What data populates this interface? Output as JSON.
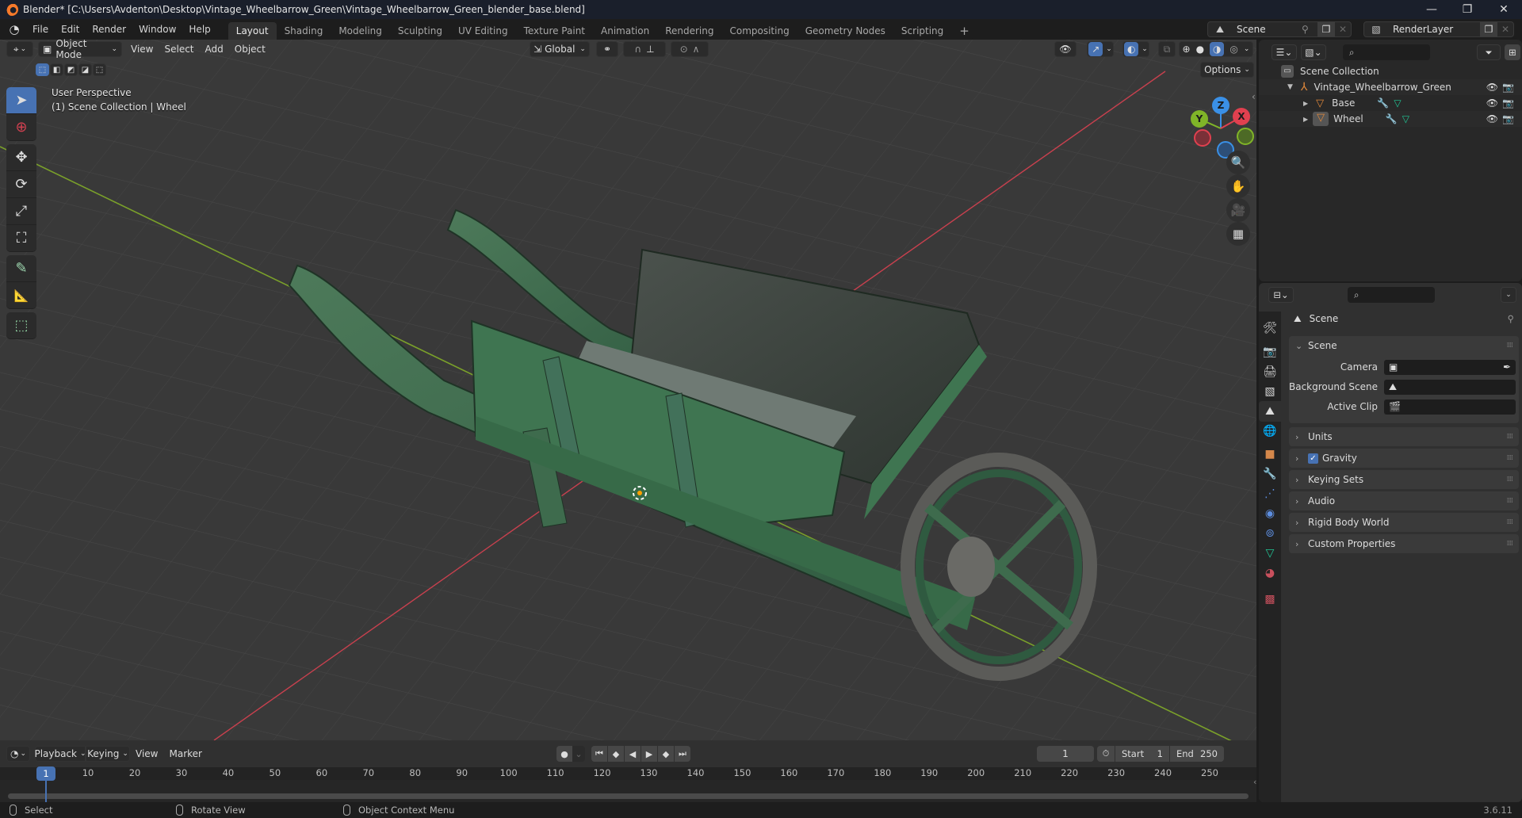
{
  "window": {
    "title": "Blender* [C:\\Users\\Avdenton\\Desktop\\Vintage_Wheelbarrow_Green\\Vintage_Wheelbarrow_Green_blender_base.blend]",
    "minimize": "—",
    "maximize": "❐",
    "close": "✕"
  },
  "menu": [
    "File",
    "Edit",
    "Render",
    "Window",
    "Help"
  ],
  "workspaces": [
    {
      "label": "Layout",
      "active": true
    },
    {
      "label": "Shading"
    },
    {
      "label": "Modeling"
    },
    {
      "label": "Sculpting"
    },
    {
      "label": "UV Editing"
    },
    {
      "label": "Texture Paint"
    },
    {
      "label": "Animation"
    },
    {
      "label": "Rendering"
    },
    {
      "label": "Compositing"
    },
    {
      "label": "Geometry Nodes"
    },
    {
      "label": "Scripting"
    }
  ],
  "add_workspace": "+",
  "scene_selector": {
    "value": "Scene"
  },
  "view_layer_selector": {
    "value": "RenderLayer"
  },
  "viewport": {
    "mode": "Object Mode",
    "menus": [
      "View",
      "Select",
      "Add",
      "Object"
    ],
    "transform_orientation": "Global",
    "options_label": "Options",
    "overlay_title": "User Perspective",
    "overlay_subtitle": "(1) Scene Collection | Wheel",
    "gizmo_axes": {
      "x": "X",
      "y": "Y",
      "z": "Z"
    },
    "colors": {
      "x_axis": "#e0404f",
      "y_axis": "#80b428",
      "z_axis": "#3a90e6",
      "grid_bg": "#393939",
      "accent": "#4772b3"
    }
  },
  "toolbar": [
    {
      "name": "select-box",
      "glyph": "➤"
    },
    {
      "name": "cursor",
      "glyph": "⊕"
    },
    {
      "name": "move",
      "glyph": "✥"
    },
    {
      "name": "rotate",
      "glyph": "⟳"
    },
    {
      "name": "scale",
      "glyph": "⤢"
    },
    {
      "name": "transform",
      "glyph": "⛶"
    },
    {
      "name": "annotate",
      "glyph": "✎"
    },
    {
      "name": "measure",
      "glyph": "📐"
    },
    {
      "name": "add-cube",
      "glyph": "⬚"
    }
  ],
  "outliner": {
    "root": "Scene Collection",
    "items": [
      {
        "label": "Vintage_Wheelbarrow_Green",
        "type": "empty",
        "depth": 1,
        "expanded": true
      },
      {
        "label": "Base",
        "type": "mesh",
        "depth": 2,
        "expanded": false
      },
      {
        "label": "Wheel",
        "type": "mesh",
        "depth": 2,
        "expanded": false,
        "active": true
      }
    ]
  },
  "properties": {
    "context_title": "Scene",
    "panels": {
      "scene": {
        "title": "Scene",
        "rows": [
          {
            "label": "Camera",
            "value": ""
          },
          {
            "label": "Background Scene",
            "value": ""
          },
          {
            "label": "Active Clip",
            "value": ""
          }
        ]
      },
      "collapsed": [
        {
          "label": "Units"
        },
        {
          "label": "Gravity",
          "checkbox": true,
          "checked": true
        },
        {
          "label": "Keying Sets"
        },
        {
          "label": "Audio"
        },
        {
          "label": "Rigid Body World"
        },
        {
          "label": "Custom Properties"
        }
      ]
    },
    "tabs": [
      "tool",
      "render",
      "output",
      "view-layer",
      "scene",
      "world",
      "object",
      "modifiers",
      "particles",
      "physics",
      "constraints",
      "data",
      "material",
      "texture"
    ]
  },
  "timeline": {
    "menus": [
      "Playback",
      "Keying",
      "View",
      "Marker"
    ],
    "current_frame": "1",
    "start_label": "Start",
    "start": "1",
    "end_label": "End",
    "end": "250",
    "ticks": [
      "1",
      "10",
      "20",
      "30",
      "40",
      "50",
      "60",
      "70",
      "80",
      "90",
      "100",
      "110",
      "120",
      "130",
      "140",
      "150",
      "160",
      "170",
      "180",
      "190",
      "200",
      "210",
      "220",
      "230",
      "240",
      "250"
    ]
  },
  "statusbar": {
    "items": [
      "Select",
      "Rotate View",
      "Object Context Menu"
    ],
    "version": "3.6.11"
  }
}
